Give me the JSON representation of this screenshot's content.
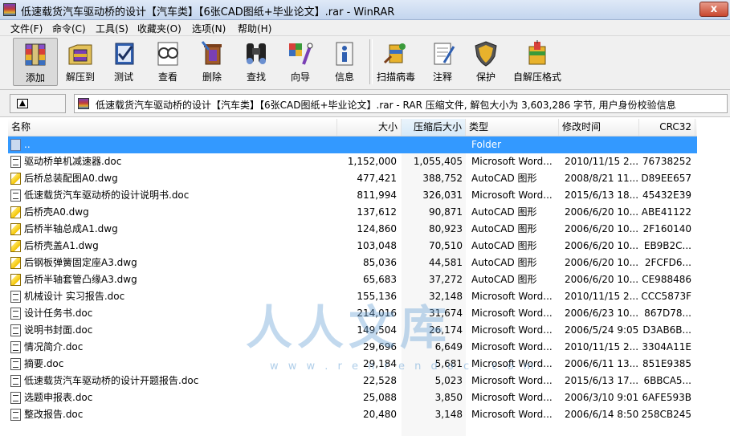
{
  "window": {
    "title": "低速载货汽车驱动桥的设计【汽车类】【6张CAD图纸+毕业论文】.rar - WinRAR",
    "close_label": "x"
  },
  "menu": [
    "文件(F)",
    "命令(C)",
    "工具(S)",
    "收藏夹(O)",
    "选项(N)",
    "帮助(H)"
  ],
  "toolbar": [
    {
      "label": "添加",
      "icon": "add-archive-icon"
    },
    {
      "label": "解压到",
      "icon": "extract-to-icon"
    },
    {
      "label": "测试",
      "icon": "test-icon"
    },
    {
      "label": "查看",
      "icon": "view-icon"
    },
    {
      "label": "删除",
      "icon": "delete-icon"
    },
    {
      "label": "查找",
      "icon": "find-icon"
    },
    {
      "label": "向导",
      "icon": "wizard-icon"
    },
    {
      "label": "信息",
      "icon": "info-icon"
    },
    {
      "label": "扫描病毒",
      "icon": "virus-scan-icon"
    },
    {
      "label": "注释",
      "icon": "comment-icon"
    },
    {
      "label": "保护",
      "icon": "protect-icon"
    },
    {
      "label": "自解压格式",
      "icon": "sfx-icon"
    }
  ],
  "address": {
    "text": "低速载货汽车驱动桥的设计【汽车类】【6张CAD图纸+毕业论文】.rar - RAR 压缩文件, 解包大小为 3,603,286 字节, 用户身份校验信息"
  },
  "columns": [
    "名称",
    "大小",
    "压缩后大小",
    "类型",
    "修改时间",
    "CRC32"
  ],
  "files": [
    {
      "name": "..",
      "size": "",
      "packed": "",
      "type": "Folder",
      "modified": "",
      "crc": "",
      "icon": "folder-icon",
      "selected": true
    },
    {
      "name": "驱动桥单机减速器.doc",
      "size": "1,152,000",
      "packed": "1,055,405",
      "type": "Microsoft Word...",
      "modified": "2010/11/15 2...",
      "crc": "76738252",
      "icon": "doc-icon"
    },
    {
      "name": "后桥总装配图A0.dwg",
      "size": "477,421",
      "packed": "388,752",
      "type": "AutoCAD 图形",
      "modified": "2008/8/21 11...",
      "crc": "D89EE657",
      "icon": "dwg-icon"
    },
    {
      "name": "低速载货汽车驱动桥的设计说明书.doc",
      "size": "811,994",
      "packed": "326,031",
      "type": "Microsoft Word...",
      "modified": "2015/6/13 18...",
      "crc": "45432E39",
      "icon": "doc-icon"
    },
    {
      "name": "后桥壳A0.dwg",
      "size": "137,612",
      "packed": "90,871",
      "type": "AutoCAD 图形",
      "modified": "2006/6/20 10...",
      "crc": "ABE41122",
      "icon": "dwg-icon"
    },
    {
      "name": "后桥半轴总成A1.dwg",
      "size": "124,860",
      "packed": "80,923",
      "type": "AutoCAD 图形",
      "modified": "2006/6/20 10...",
      "crc": "2F160140",
      "icon": "dwg-icon"
    },
    {
      "name": "后桥壳盖A1.dwg",
      "size": "103,048",
      "packed": "70,510",
      "type": "AutoCAD 图形",
      "modified": "2006/6/20 10...",
      "crc": "EB9B2C...",
      "icon": "dwg-icon"
    },
    {
      "name": "后钢板弹簧固定座A3.dwg",
      "size": "85,036",
      "packed": "44,581",
      "type": "AutoCAD 图形",
      "modified": "2006/6/20 10...",
      "crc": "2FCFD6...",
      "icon": "dwg-icon"
    },
    {
      "name": "后桥半轴套管凸缘A3.dwg",
      "size": "65,683",
      "packed": "37,272",
      "type": "AutoCAD 图形",
      "modified": "2006/6/20 10...",
      "crc": "CE988486",
      "icon": "dwg-icon"
    },
    {
      "name": "机械设计 实习报告.doc",
      "size": "155,136",
      "packed": "32,148",
      "type": "Microsoft Word...",
      "modified": "2010/11/15 2...",
      "crc": "CCC5873F",
      "icon": "doc-icon"
    },
    {
      "name": "设计任务书.doc",
      "size": "214,016",
      "packed": "31,674",
      "type": "Microsoft Word...",
      "modified": "2006/6/23 10...",
      "crc": "867D78...",
      "icon": "doc-icon"
    },
    {
      "name": "说明书封面.doc",
      "size": "149,504",
      "packed": "26,174",
      "type": "Microsoft Word...",
      "modified": "2006/5/24 9:05",
      "crc": "D3AB6B...",
      "icon": "doc-icon"
    },
    {
      "name": "情况简介.doc",
      "size": "29,696",
      "packed": "6,649",
      "type": "Microsoft Word...",
      "modified": "2010/11/15 2...",
      "crc": "3304A11E",
      "icon": "doc-icon"
    },
    {
      "name": "摘要.doc",
      "size": "29,184",
      "packed": "5,681",
      "type": "Microsoft Word...",
      "modified": "2006/6/11 13...",
      "crc": "851E9385",
      "icon": "doc-icon"
    },
    {
      "name": "低速载货汽车驱动桥的设计开题报告.doc",
      "size": "22,528",
      "packed": "5,023",
      "type": "Microsoft Word...",
      "modified": "2015/6/13 17...",
      "crc": "6BBCA5...",
      "icon": "doc-icon"
    },
    {
      "name": "选题申报表.doc",
      "size": "25,088",
      "packed": "3,850",
      "type": "Microsoft Word...",
      "modified": "2006/3/10 9:01",
      "crc": "6AFE593B",
      "icon": "doc-icon"
    },
    {
      "name": "整改报告.doc",
      "size": "20,480",
      "packed": "3,148",
      "type": "Microsoft Word...",
      "modified": "2006/6/14 8:50",
      "crc": "258CB245",
      "icon": "doc-icon"
    }
  ],
  "watermark": {
    "text": "人人文库",
    "url": "w w w . r e n r e n d o c . c o m"
  },
  "colors": {
    "selection": "#3399ff",
    "sorted_column": "#f7f7f7"
  }
}
